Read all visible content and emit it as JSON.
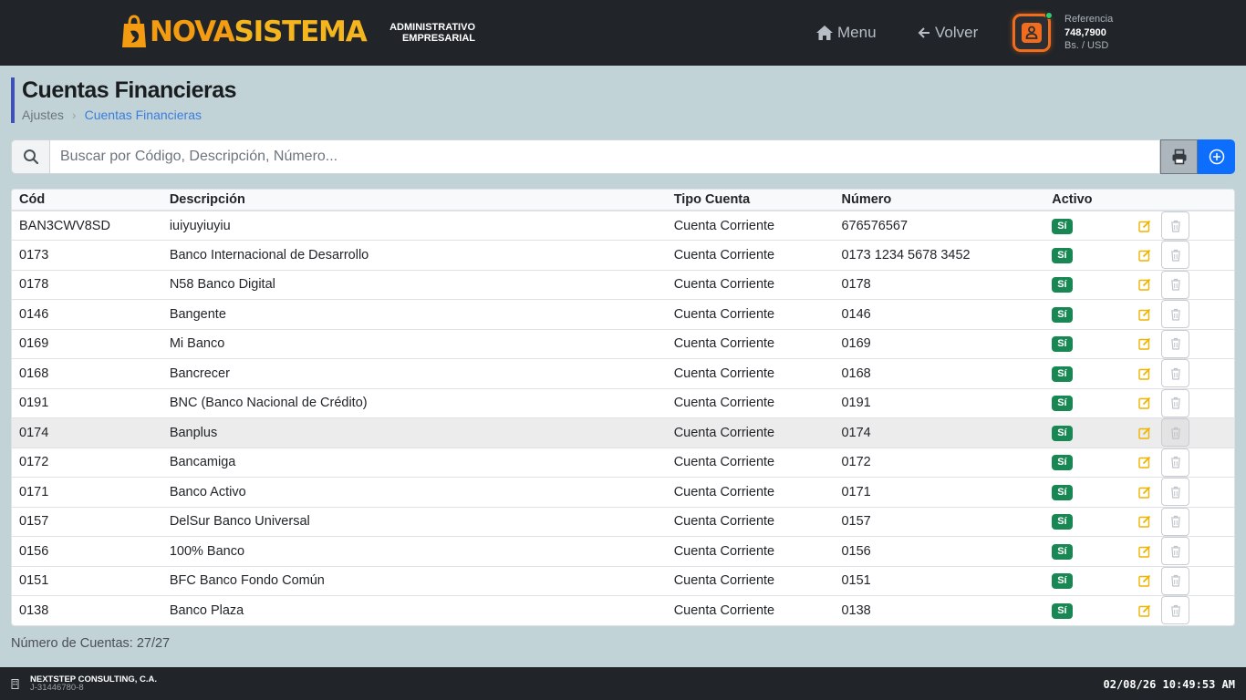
{
  "header": {
    "logo_nova": "NOVA",
    "logo_sistema": "SISTEMA",
    "logo_sub_1": "ADMINISTRATIVO",
    "logo_sub_2": "EMPRESARIAL",
    "nav_menu": "Menu",
    "nav_volver": "Volver",
    "rate_label": "Referencia",
    "rate_value": "748,7900",
    "rate_unit": "Bs. / USD"
  },
  "page": {
    "title": "Cuentas Financieras",
    "breadcrumb": [
      "Ajustes",
      "Cuentas Financieras"
    ],
    "breadcrumb_sep": "›"
  },
  "search": {
    "placeholder": "Buscar por Código, Descripción, Número..."
  },
  "table": {
    "columns": [
      "Cód",
      "Descripción",
      "Tipo Cuenta",
      "Número",
      "Activo"
    ],
    "rows": [
      {
        "cod": "BAN3CWV8SD",
        "desc": "iuiyuyiuyiu",
        "tipo": "Cuenta Corriente",
        "numero": "676576567",
        "activo": "Sí"
      },
      {
        "cod": "0173",
        "desc": "Banco Internacional de Desarrollo",
        "tipo": "Cuenta Corriente",
        "numero": "0173 1234 5678 3452",
        "activo": "Sí"
      },
      {
        "cod": "0178",
        "desc": "N58 Banco Digital",
        "tipo": "Cuenta Corriente",
        "numero": "0178",
        "activo": "Sí"
      },
      {
        "cod": "0146",
        "desc": "Bangente",
        "tipo": "Cuenta Corriente",
        "numero": "0146",
        "activo": "Sí"
      },
      {
        "cod": "0169",
        "desc": "Mi Banco",
        "tipo": "Cuenta Corriente",
        "numero": "0169",
        "activo": "Sí"
      },
      {
        "cod": "0168",
        "desc": "Bancrecer",
        "tipo": "Cuenta Corriente",
        "numero": "0168",
        "activo": "Sí"
      },
      {
        "cod": "0191",
        "desc": "BNC (Banco Nacional de Crédito)",
        "tipo": "Cuenta Corriente",
        "numero": "0191",
        "activo": "Sí"
      },
      {
        "cod": "0174",
        "desc": "Banplus",
        "tipo": "Cuenta Corriente",
        "numero": "0174",
        "activo": "Sí"
      },
      {
        "cod": "0172",
        "desc": "Bancamiga",
        "tipo": "Cuenta Corriente",
        "numero": "0172",
        "activo": "Sí"
      },
      {
        "cod": "0171",
        "desc": "Banco Activo",
        "tipo": "Cuenta Corriente",
        "numero": "0171",
        "activo": "Sí"
      },
      {
        "cod": "0157",
        "desc": "DelSur Banco Universal",
        "tipo": "Cuenta Corriente",
        "numero": "0157",
        "activo": "Sí"
      },
      {
        "cod": "0156",
        "desc": "100% Banco",
        "tipo": "Cuenta Corriente",
        "numero": "0156",
        "activo": "Sí"
      },
      {
        "cod": "0151",
        "desc": "BFC Banco Fondo Común",
        "tipo": "Cuenta Corriente",
        "numero": "0151",
        "activo": "Sí"
      },
      {
        "cod": "0138",
        "desc": "Banco Plaza",
        "tipo": "Cuenta Corriente",
        "numero": "0138",
        "activo": "Sí"
      }
    ],
    "highlighted_row": 7
  },
  "summary": {
    "count_text": "Número de Cuentas: 27/27"
  },
  "footer": {
    "company": "NEXTSTEP CONSULTING, C.A.",
    "rif": "J-31446780-8",
    "clock": "02/08/26 10:49:53 AM"
  },
  "icons": {
    "menu": "home-icon",
    "volver": "arrow-left-icon",
    "user": "user-icon",
    "search": "search-icon",
    "print": "printer-icon",
    "add": "plus-circle-icon",
    "edit": "edit-icon",
    "delete": "trash-icon",
    "footer": "building-icon"
  },
  "colors": {
    "accent": "#0d6efd",
    "brand_orange": "#f39c12",
    "badge_green": "#198754",
    "topbar": "#212529",
    "background": "#c2d3d7"
  }
}
